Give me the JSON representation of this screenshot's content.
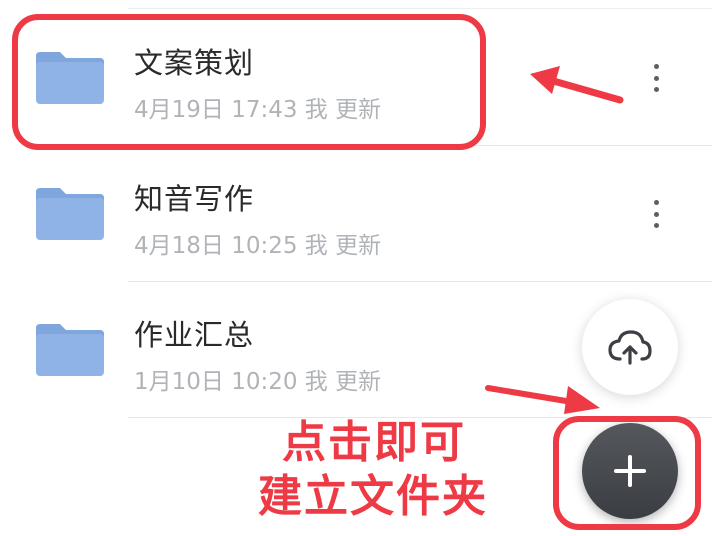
{
  "folders": [
    {
      "name": "文案策划",
      "meta": "4月19日 17:43 我 更新"
    },
    {
      "name": "知音写作",
      "meta": "4月18日 10:25 我 更新"
    },
    {
      "name": "作业汇总",
      "meta": "1月10日 10:20 我 更新"
    }
  ],
  "icons": {
    "folder": "folder-icon",
    "more": "more-vertical-icon",
    "upload": "cloud-upload-icon",
    "add": "plus-icon"
  },
  "annotation": {
    "line1": "点击即可",
    "line2": "建立文件夹",
    "color": "#ee3a44"
  },
  "colors": {
    "folder_body": "#8fb3e6",
    "folder_tab": "#7fa6dd",
    "fab_dark": "#45484d",
    "annotation_red": "#ee3a44"
  }
}
